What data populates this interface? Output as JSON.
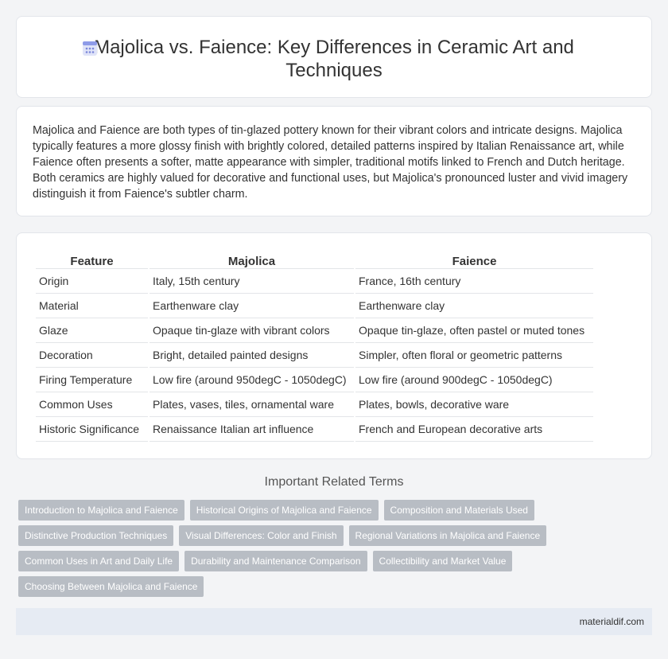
{
  "header": {
    "title": "Majolica vs. Faience: Key Differences in Ceramic Art and Techniques",
    "icon": "document-icon"
  },
  "intro": {
    "text": "Majolica and Faience are both types of tin-glazed pottery known for their vibrant colors and intricate designs. Majolica typically features a more glossy finish with brightly colored, detailed patterns inspired by Italian Renaissance art, while Faience often presents a softer, matte appearance with simpler, traditional motifs linked to French and Dutch heritage. Both ceramics are highly valued for decorative and functional uses, but Majolica's pronounced luster and vivid imagery distinguish it from Faience's subtler charm."
  },
  "table": {
    "headers": [
      "Feature",
      "Majolica",
      "Faience"
    ],
    "rows": [
      [
        "Origin",
        "Italy, 15th century",
        "France, 16th century"
      ],
      [
        "Material",
        "Earthenware clay",
        "Earthenware clay"
      ],
      [
        "Glaze",
        "Opaque tin-glaze with vibrant colors",
        "Opaque tin-glaze, often pastel or muted tones"
      ],
      [
        "Decoration",
        "Bright, detailed painted designs",
        "Simpler, often floral or geometric patterns"
      ],
      [
        "Firing Temperature",
        "Low fire (around 950degC - 1050degC)",
        "Low fire (around 900degC - 1050degC)"
      ],
      [
        "Common Uses",
        "Plates, vases, tiles, ornamental ware",
        "Plates, bowls, decorative ware"
      ],
      [
        "Historic Significance",
        "Renaissance Italian art influence",
        "French and European decorative arts"
      ]
    ]
  },
  "related": {
    "title": "Important Related Terms",
    "rows": [
      [
        "Introduction to Majolica and Faience",
        "Historical Origins of Majolica and Faience",
        "Composition and Materials Used"
      ],
      [
        "Distinctive Production Techniques",
        "Visual Differences: Color and Finish",
        "Regional Variations in Majolica and Faience"
      ],
      [
        "Common Uses in Art and Daily Life",
        "Durability and Maintenance Comparison",
        "Collectibility and Market Value"
      ],
      [
        "Choosing Between Majolica and Faience"
      ]
    ]
  },
  "footer": {
    "site": "materialdif.com"
  }
}
